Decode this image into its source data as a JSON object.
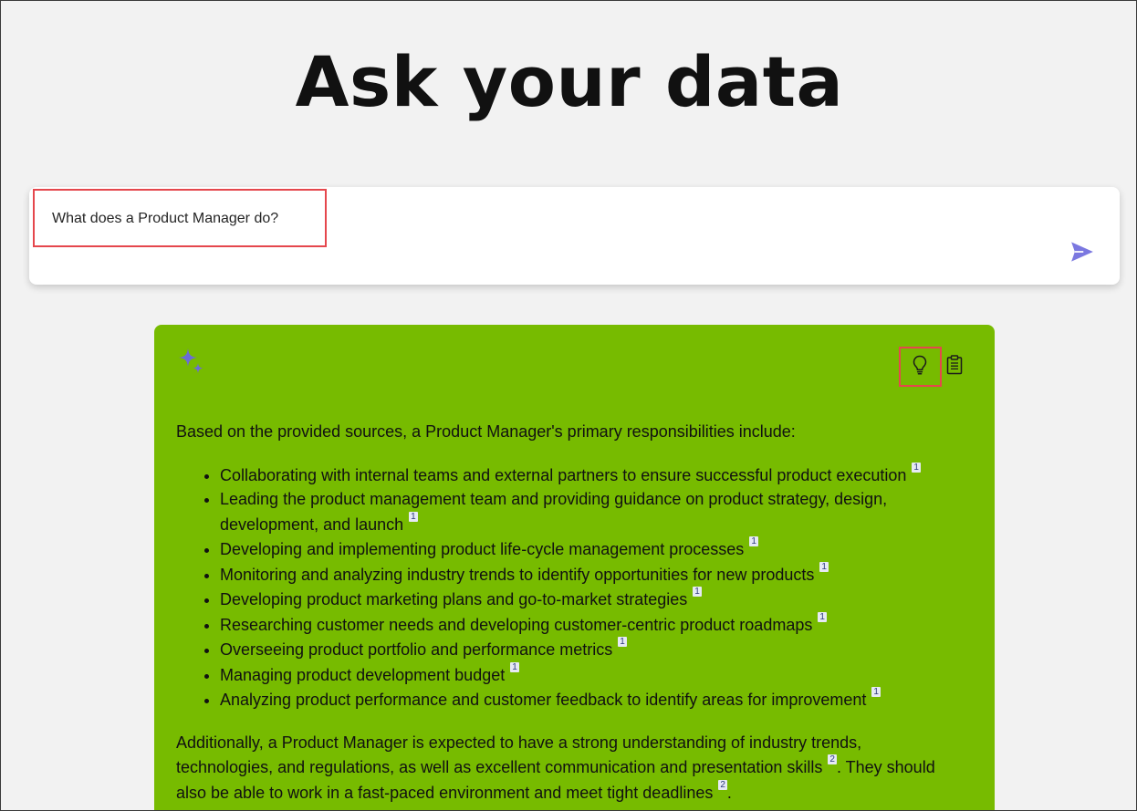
{
  "page": {
    "title": "Ask your data"
  },
  "ask": {
    "question": "What does a Product Manager do?",
    "send_icon": "send-icon"
  },
  "answer": {
    "icons": {
      "assistant": "sparkle-icon",
      "hint": "lightbulb-icon",
      "copy": "clipboard-icon"
    },
    "intro": "Based on the provided sources, a Product Manager's primary responsibilities include:",
    "bullets": [
      {
        "text": "Collaborating with internal teams and external partners to ensure successful product execution",
        "cite": "1"
      },
      {
        "text": "Leading the product management team and providing guidance on product strategy, design, development, and launch",
        "cite": "1"
      },
      {
        "text": "Developing and implementing product life-cycle management processes",
        "cite": "1"
      },
      {
        "text": "Monitoring and analyzing industry trends to identify opportunities for new products",
        "cite": "1"
      },
      {
        "text": "Developing product marketing plans and go-to-market strategies",
        "cite": "1"
      },
      {
        "text": "Researching customer needs and developing customer-centric product roadmaps",
        "cite": "1"
      },
      {
        "text": "Overseeing product portfolio and performance metrics",
        "cite": "1"
      },
      {
        "text": "Managing product development budget",
        "cite": "1"
      },
      {
        "text": "Analyzing product performance and customer feedback to identify areas for improvement",
        "cite": "1"
      }
    ],
    "closing": {
      "part1": "Additionally, a Product Manager is expected to have a strong understanding of industry trends, technologies, and regulations, as well as excellent communication and presentation skills",
      "cite1": "2",
      "part2": ". They should also be able to work in a fast-paced environment and meet tight deadlines",
      "cite2": "2",
      "part3": "."
    }
  },
  "colors": {
    "background": "#f2f2f2",
    "card": "#77bb00",
    "accent": "#6b6bd8",
    "highlight": "#e5474d"
  }
}
